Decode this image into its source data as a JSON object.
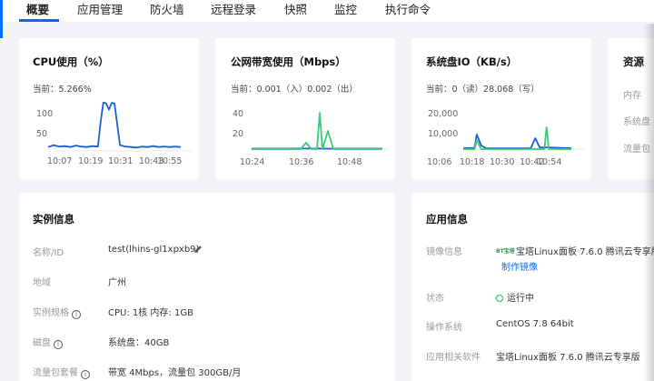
{
  "tabs": [
    "概要",
    "应用管理",
    "防火墙",
    "远程登录",
    "快照",
    "监控",
    "执行命令"
  ],
  "accent_color": "#006eff",
  "cpu": {
    "title": "CPU使用（%）",
    "current": "当前：5.266%",
    "y_ticks": [
      "100",
      "50"
    ],
    "x_ticks": [
      "10:07",
      "10:19",
      "10:31",
      "10:43",
      "10:55"
    ]
  },
  "bandwidth": {
    "title": "公网带宽使用（Mbps）",
    "current": "当前：0.001（入）0.002（出）",
    "y_ticks": [
      "40",
      "20"
    ],
    "x_ticks": [
      "10:24",
      "10:36",
      "10:48"
    ]
  },
  "disk": {
    "title": "系统盘IO（KB/s）",
    "current": "当前：0（读）28.068（写）",
    "y_ticks": [
      "20,000",
      "10,000"
    ],
    "x_ticks": [
      "10:06",
      "10:18",
      "10:30",
      "10:42",
      "10:54"
    ]
  },
  "resource": {
    "title": "资源",
    "rows": [
      "内存",
      "系统盘",
      "流量包"
    ]
  },
  "instance_info": {
    "title": "实例信息",
    "rows": [
      {
        "label": "名称/ID",
        "value": "test(lhins-gl1xpxb9)"
      },
      {
        "label": "地域",
        "value": "广州"
      },
      {
        "label": "实例规格",
        "value": "CPU: 1核 内存: 1GB"
      },
      {
        "label": "磁盘",
        "value": "系统盘：40GB"
      },
      {
        "label": "流量包套餐",
        "value": "带宽 4Mbps，流量包 300GB/月"
      }
    ]
  },
  "app_info": {
    "title": "应用信息",
    "rows": [
      {
        "label": "镜像信息",
        "value": "宝塔Linux面板 7.6.0 腾讯云专享版"
      },
      {
        "label": "状态",
        "value": "运行中"
      },
      {
        "label": "操作系统",
        "value": "CentOS 7.8 64bit"
      },
      {
        "label": "应用相关软件",
        "value": "宝塔Linux面板 7.6.0 腾讯云专享版"
      }
    ],
    "make_image_link": "制作镜像",
    "bt_logo": "BT宝塔"
  },
  "chart_data": [
    {
      "type": "line",
      "title": "CPU使用（%）",
      "x_ticks": [
        "10:07",
        "10:19",
        "10:31",
        "10:43",
        "10:55"
      ],
      "ylim": [
        0,
        120
      ],
      "series": [
        {
          "color": "#1a5fd6",
          "x": [
            0,
            2,
            4,
            6,
            8,
            10,
            12,
            14,
            16,
            18,
            19,
            20,
            21,
            22,
            23,
            24,
            26,
            28,
            30,
            32,
            34,
            36,
            38,
            40,
            42,
            44,
            46,
            48
          ],
          "y": [
            8,
            12,
            9,
            10,
            8,
            11,
            9,
            8,
            10,
            9,
            60,
            100,
            98,
            85,
            99,
            98,
            12,
            9,
            8,
            7,
            9,
            8,
            10,
            8,
            9,
            8,
            9,
            8
          ]
        }
      ]
    },
    {
      "type": "line",
      "title": "公网带宽使用（Mbps）",
      "x_ticks": [
        "10:24",
        "10:36",
        "10:48"
      ],
      "ylim": [
        0,
        50
      ],
      "series": [
        {
          "color": "#1a5fd6",
          "x": [
            0,
            10,
            20,
            30,
            40,
            48
          ],
          "y": [
            0.5,
            0.5,
            0.6,
            0.5,
            0.5,
            0.5
          ]
        },
        {
          "color": "#3cc878",
          "x": [
            0,
            18,
            20,
            22,
            24,
            25,
            26,
            28,
            30,
            48
          ],
          "y": [
            0,
            0,
            7,
            0,
            0,
            40,
            0,
            20,
            0,
            0
          ]
        }
      ]
    },
    {
      "type": "line",
      "title": "系统盘IO（KB/s）",
      "x_ticks": [
        "10:06",
        "10:18",
        "10:30",
        "10:42",
        "10:54"
      ],
      "ylim": [
        0,
        25000
      ],
      "series": [
        {
          "color": "#1a5fd6",
          "x": [
            0,
            5,
            6,
            8,
            10,
            20,
            30,
            32,
            34,
            36,
            48
          ],
          "y": [
            500,
            600,
            8000,
            2000,
            500,
            400,
            500,
            6000,
            800,
            1000,
            500
          ]
        },
        {
          "color": "#3cc878",
          "x": [
            0,
            5,
            6,
            8,
            10,
            30,
            34,
            36,
            37,
            38,
            48
          ],
          "y": [
            0,
            0,
            5000,
            0,
            0,
            0,
            0,
            0,
            12000,
            0,
            0
          ]
        }
      ]
    }
  ]
}
